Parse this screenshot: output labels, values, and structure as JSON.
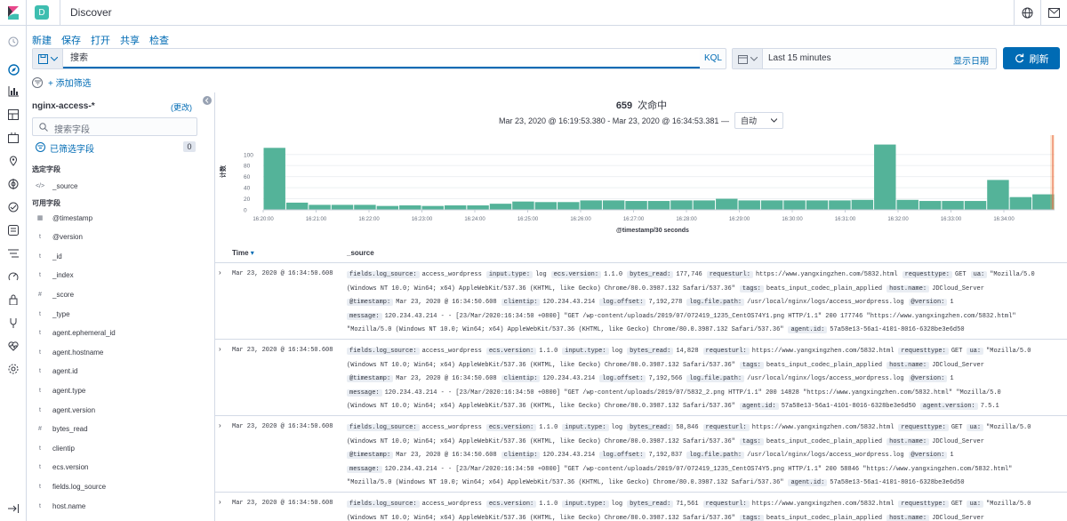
{
  "header": {
    "space_letter": "D",
    "title": "Discover"
  },
  "menu": [
    "新建",
    "保存",
    "打开",
    "共享",
    "检查"
  ],
  "query": {
    "placeholder": "搜索",
    "language": "KQL"
  },
  "time": {
    "range": "Last 15 minutes",
    "show_dates": "显示日期",
    "refresh": "刷新"
  },
  "filter": {
    "add": "+ 添加筛选"
  },
  "sidebar": {
    "index_pattern": "nginx-access-*",
    "change": "(更改)",
    "search_placeholder": "搜索字段",
    "filtered_label": "已筛选字段",
    "filtered_count": "0",
    "selected_title": "选定字段",
    "selected": [
      {
        "type": "</>",
        "name": "_source"
      }
    ],
    "available_title": "可用字段",
    "fields": [
      {
        "type": "▦",
        "name": "@timestamp"
      },
      {
        "type": "t",
        "name": "@version"
      },
      {
        "type": "t",
        "name": "_id"
      },
      {
        "type": "t",
        "name": "_index"
      },
      {
        "type": "#",
        "name": "_score"
      },
      {
        "type": "t",
        "name": "_type"
      },
      {
        "type": "t",
        "name": "agent.ephemeral_id"
      },
      {
        "type": "t",
        "name": "agent.hostname"
      },
      {
        "type": "t",
        "name": "agent.id"
      },
      {
        "type": "t",
        "name": "agent.type"
      },
      {
        "type": "t",
        "name": "agent.version"
      },
      {
        "type": "#",
        "name": "bytes_read"
      },
      {
        "type": "t",
        "name": "clientip"
      },
      {
        "type": "t",
        "name": "ecs.version"
      },
      {
        "type": "t",
        "name": "fields.log_source"
      },
      {
        "type": "t",
        "name": "host.name"
      }
    ]
  },
  "results": {
    "count": "659",
    "label": "次命中",
    "range": "Mar 23, 2020 @ 16:19:53.380 - Mar 23, 2020 @ 16:34:53.381 —",
    "interval": "自动"
  },
  "chart_data": {
    "type": "bar",
    "ylabel": "计数",
    "xlabel": "@timestamp/30 seconds",
    "yticks": [
      0,
      20,
      40,
      60,
      80,
      100
    ],
    "ylim": [
      0,
      135
    ],
    "xticks": [
      "16:20:00",
      "16:21:00",
      "16:22:00",
      "16:23:00",
      "16:24:00",
      "16:25:00",
      "16:26:00",
      "16:27:00",
      "16:28:00",
      "16:29:00",
      "16:30:00",
      "16:31:00",
      "16:32:00",
      "16:33:00",
      "16:34:00"
    ],
    "values": [
      112,
      13,
      9,
      9,
      9,
      7,
      8,
      7,
      8,
      8,
      11,
      15,
      14,
      14,
      17,
      17,
      16,
      16,
      17,
      17,
      20,
      17,
      17,
      17,
      17,
      17,
      18,
      118,
      18,
      16,
      16,
      16,
      54,
      23,
      28
    ],
    "bar_color": "#54b399"
  },
  "table": {
    "columns": [
      "Time",
      "_source"
    ],
    "rows": [
      {
        "time": "Mar 23, 2020 @ 16:34:50.608",
        "lines": [
          [
            [
              "fields.log_source:",
              "access_wordpress"
            ],
            [
              "input.type:",
              "log"
            ],
            [
              "ecs.version:",
              "1.1.0"
            ],
            [
              "bytes_read:",
              "177,746"
            ],
            [
              "requesturl:",
              "https://www.yangxingzhen.com/5832.html"
            ],
            [
              "requesttype:",
              "GET"
            ],
            [
              "ua:",
              "\"Mozilla/5.0"
            ]
          ],
          [
            [
              "",
              "(Windows NT 10.0; Win64; x64) AppleWebKit/537.36 (KHTML, like Gecko) Chrome/80.0.3987.132 Safari/537.36\""
            ],
            [
              "tags:",
              "beats_input_codec_plain_applied"
            ],
            [
              "host.name:",
              "JDCloud_Server"
            ]
          ],
          [
            [
              "@timestamp:",
              "Mar 23, 2020 @ 16:34:50.608"
            ],
            [
              "clientip:",
              "120.234.43.214"
            ],
            [
              "log.offset:",
              "7,192,278"
            ],
            [
              "log.file.path:",
              "/usr/local/nginx/logs/access_wordpress.log"
            ],
            [
              "@version:",
              "1"
            ]
          ],
          [
            [
              "message:",
              "120.234.43.214 - - [23/Mar/2020:16:34:50 +0800] \"GET /wp-content/uploads/2019/07/072419_1235_CentOS74Y1.png HTTP/1.1\" 200 177746 \"https://www.yangxingzhen.com/5832.html\""
            ]
          ],
          [
            [
              "",
              "\"Mozilla/5.0 (Windows NT 10.0; Win64; x64) AppleWebKit/537.36 (KHTML, like Gecko) Chrome/80.0.3987.132 Safari/537.36\""
            ],
            [
              "agent.id:",
              "57a58e13-56a1-4101-8016-6328be3e6d50"
            ]
          ]
        ]
      },
      {
        "time": "Mar 23, 2020 @ 16:34:50.608",
        "lines": [
          [
            [
              "fields.log_source:",
              "access_wordpress"
            ],
            [
              "ecs.version:",
              "1.1.0"
            ],
            [
              "input.type:",
              "log"
            ],
            [
              "bytes_read:",
              "14,828"
            ],
            [
              "requesturl:",
              "https://www.yangxingzhen.com/5832.html"
            ],
            [
              "requesttype:",
              "GET"
            ],
            [
              "ua:",
              "\"Mozilla/5.0"
            ]
          ],
          [
            [
              "",
              "(Windows NT 10.0; Win64; x64) AppleWebKit/537.36 (KHTML, like Gecko) Chrome/80.0.3987.132 Safari/537.36\""
            ],
            [
              "tags:",
              "beats_input_codec_plain_applied"
            ],
            [
              "host.name:",
              "JDCloud_Server"
            ]
          ],
          [
            [
              "@timestamp:",
              "Mar 23, 2020 @ 16:34:50.608"
            ],
            [
              "clientip:",
              "120.234.43.214"
            ],
            [
              "log.offset:",
              "7,192,566"
            ],
            [
              "log.file.path:",
              "/usr/local/nginx/logs/access_wordpress.log"
            ],
            [
              "@version:",
              "1"
            ]
          ],
          [
            [
              "message:",
              "120.234.43.214 - - [23/Mar/2020:16:34:50 +0800] \"GET /wp-content/uploads/2019/07/5832_2.png HTTP/1.1\" 200 14828 \"https://www.yangxingzhen.com/5832.html\" \"Mozilla/5.0"
            ]
          ],
          [
            [
              "",
              "(Windows NT 10.0; Win64; x64) AppleWebKit/537.36 (KHTML, like Gecko) Chrome/80.0.3987.132 Safari/537.36\""
            ],
            [
              "agent.id:",
              "57a58e13-56a1-4101-8016-6328be3e6d50"
            ],
            [
              "agent.version:",
              "7.5.1"
            ]
          ]
        ]
      },
      {
        "time": "Mar 23, 2020 @ 16:34:50.608",
        "lines": [
          [
            [
              "fields.log_source:",
              "access_wordpress"
            ],
            [
              "ecs.version:",
              "1.1.0"
            ],
            [
              "input.type:",
              "log"
            ],
            [
              "bytes_read:",
              "58,846"
            ],
            [
              "requesturl:",
              "https://www.yangxingzhen.com/5832.html"
            ],
            [
              "requesttype:",
              "GET"
            ],
            [
              "ua:",
              "\"Mozilla/5.0"
            ]
          ],
          [
            [
              "",
              "(Windows NT 10.0; Win64; x64) AppleWebKit/537.36 (KHTML, like Gecko) Chrome/80.0.3987.132 Safari/537.36\""
            ],
            [
              "tags:",
              "beats_input_codec_plain_applied"
            ],
            [
              "host.name:",
              "JDCloud_Server"
            ]
          ],
          [
            [
              "@timestamp:",
              "Mar 23, 2020 @ 16:34:50.608"
            ],
            [
              "clientip:",
              "120.234.43.214"
            ],
            [
              "log.offset:",
              "7,192,837"
            ],
            [
              "log.file.path:",
              "/usr/local/nginx/logs/access_wordpress.log"
            ],
            [
              "@version:",
              "1"
            ]
          ],
          [
            [
              "message:",
              "120.234.43.214 - - [23/Mar/2020:16:34:50 +0800] \"GET /wp-content/uploads/2019/07/072419_1235_CentOS74Y5.png HTTP/1.1\" 200 58846 \"https://www.yangxingzhen.com/5832.html\""
            ]
          ],
          [
            [
              "",
              "\"Mozilla/5.0 (Windows NT 10.0; Win64; x64) AppleWebKit/537.36 (KHTML, like Gecko) Chrome/80.0.3987.132 Safari/537.36\""
            ],
            [
              "agent.id:",
              "57a58e13-56a1-4101-8016-6328be3e6d50"
            ]
          ]
        ]
      },
      {
        "time": "Mar 23, 2020 @ 16:34:50.608",
        "lines": [
          [
            [
              "fields.log_source:",
              "access_wordpress"
            ],
            [
              "ecs.version:",
              "1.1.0"
            ],
            [
              "input.type:",
              "log"
            ],
            [
              "bytes_read:",
              "71,561"
            ],
            [
              "requesturl:",
              "https://www.yangxingzhen.com/5832.html"
            ],
            [
              "requesttype:",
              "GET"
            ],
            [
              "ua:",
              "\"Mozilla/5.0"
            ]
          ],
          [
            [
              "",
              "(Windows NT 10.0; Win64; x64) AppleWebKit/537.36 (KHTML, like Gecko) Chrome/80.0.3987.132 Safari/537.36\""
            ],
            [
              "tags:",
              "beats_input_codec_plain_applied"
            ],
            [
              "host.name:",
              "JDCloud_Server"
            ]
          ]
        ]
      }
    ]
  }
}
